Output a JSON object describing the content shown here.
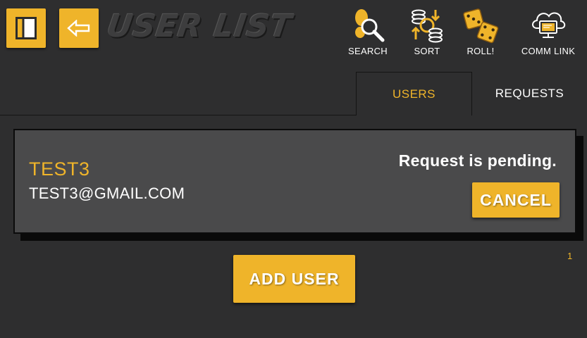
{
  "header": {
    "logo_text": "USER LIST",
    "tools": {
      "search": "SEARCH",
      "sort": "SORT",
      "roll": "ROLL!",
      "comm": "COMM LINK"
    }
  },
  "tabs": {
    "users": "USERS",
    "requests": "REQUESTS",
    "active": "USERS"
  },
  "request": {
    "name": "TEST3",
    "email": "TEST3@GMAIL.COM",
    "status": "Request is pending.",
    "cancel_label": "CANCEL"
  },
  "count": "1",
  "add_user_label": "ADD USER",
  "colors": {
    "accent": "#efb42a",
    "background": "#2e2e2f",
    "card": "#4a4a4b"
  }
}
